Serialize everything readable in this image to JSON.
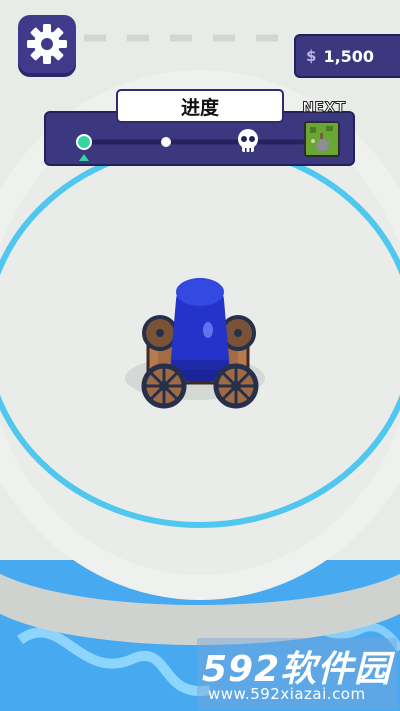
{
  "hud": {
    "currency_symbol": "$",
    "coins": "1,500",
    "progress_title": "进度",
    "next_label": "NEXT",
    "progress_level": 0
  },
  "icons": {
    "settings": "gear-icon",
    "milestone_boss": "skull-icon",
    "current_marker": "triangle-up-icon",
    "next_preview": "castle-thumbnail"
  },
  "watermark": {
    "brand": "592软件园",
    "url": "www.592xiazai.com"
  },
  "colors": {
    "panel": "#3c3880",
    "progress_active": "#33d6a0",
    "arena_ring": "#4fc7ef",
    "cannon": "#2535c4",
    "water": "#4aaef0"
  }
}
